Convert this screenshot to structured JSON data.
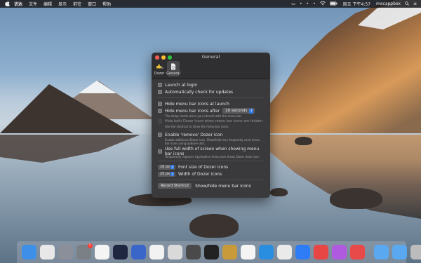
{
  "menubar": {
    "app_name": "访达",
    "items": [
      "文件",
      "编辑",
      "显示",
      "前往",
      "窗口",
      "帮助"
    ],
    "clock": "周五 下午4:57",
    "username": "macappbox",
    "status_icons": [
      "tray-icon",
      "dot-icon",
      "dot-icon",
      "dot-icon",
      "wifi-icon",
      "battery-icon"
    ]
  },
  "window": {
    "title": "General",
    "tabs": [
      {
        "label": "Dozer",
        "icon": "dozer-icon"
      },
      {
        "label": "General",
        "icon": "general-icon"
      }
    ],
    "settings": {
      "launch_at_login": "Launch at login",
      "auto_check_updates": "Automatically check for updates",
      "hide_at_launch": "Hide menu bar icons at launch",
      "hide_after": "Hide menu bar icons after",
      "hide_after_value": "10 seconds",
      "hide_after_hint": "The delay resets when you interact with the menu bar.",
      "hide_both_icons": "Hide both Dozer icons when menu bar icons are hidden",
      "hide_both_hint": "Use the shortcut to show the menu bar icons.",
      "enable_remove_icon": "Enable 'remove' Dozer icon",
      "enable_remove_hint": "Enable additional Dozer icon. Show/hide less frequently used menu bar icons using option+click.",
      "full_width": "Use full width of screen when showing menu bar icons",
      "full_width_hint": "Temporarily replaces Application menu and shows Dozer dock icon.",
      "font_size_value": "10 px",
      "font_size_label": "Font size of Dozer icons",
      "width_value": "25 px",
      "width_label": "Width of Dozer icons",
      "record_shortcut": "Record Shortcut",
      "shortcut_label": "Show/hide menu bar icons"
    }
  },
  "dock": {
    "apps": [
      {
        "name": "finder-icon",
        "color": "#3d8fe8"
      },
      {
        "name": "chrome-icon",
        "color": "#e8e8e8"
      },
      {
        "name": "launchpad-icon",
        "color": "#8a8f99"
      },
      {
        "name": "system-preferences-icon",
        "color": "#7b7f86",
        "badge": "1"
      },
      {
        "name": "wechat-icon",
        "color": "#f4f4f4"
      },
      {
        "name": "screen-saver-icon",
        "color": "#1f2740"
      },
      {
        "name": "rocket-app-icon",
        "color": "#3a66c9"
      },
      {
        "name": "qq-icon",
        "color": "#f2f2f2"
      },
      {
        "name": "printer-icon",
        "color": "#d9d9d9"
      },
      {
        "name": "photo-app-icon",
        "color": "#4a4a4a"
      },
      {
        "name": "terminal-icon",
        "color": "#222222"
      },
      {
        "name": "archive-utility-icon",
        "color": "#c89a3a"
      },
      {
        "name": "photos-app-icon",
        "color": "#f4f4f4"
      },
      {
        "name": "xcode-icon",
        "color": "#2a8ee0"
      },
      {
        "name": "safari-icon",
        "color": "#eaeaea"
      },
      {
        "name": "chat-bubbles-icon",
        "color": "#2e7cf6"
      },
      {
        "name": "video-app-icon",
        "color": "#e84545"
      },
      {
        "name": "podcast-app-icon",
        "color": "#b05ae0"
      },
      {
        "name": "arrow-app-icon",
        "color": "#e84a4a"
      }
    ],
    "folders": [
      {
        "name": "downloads-folder-icon",
        "color": "#5aa8f0"
      },
      {
        "name": "documents-folder-icon",
        "color": "#5aa8f0"
      },
      {
        "name": "trash-icon",
        "color": "#bcbcbc"
      }
    ]
  }
}
